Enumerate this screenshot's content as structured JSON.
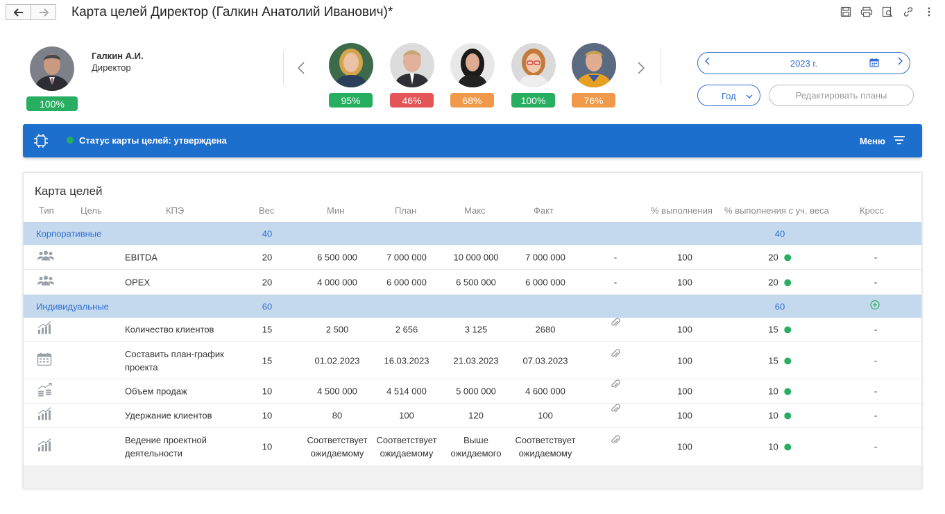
{
  "window": {
    "title": "Карта целей Директор (Галкин Анатолий Иванович)*"
  },
  "profile": {
    "name": "Галкин А.И.",
    "role": "Директор",
    "percent": "100%"
  },
  "team": [
    {
      "percent": "95%",
      "color": "#27ae60"
    },
    {
      "percent": "46%",
      "color": "#e45558"
    },
    {
      "percent": "68%",
      "color": "#f0994a"
    },
    {
      "percent": "100%",
      "color": "#27ae60"
    },
    {
      "percent": "76%",
      "color": "#f0994a"
    }
  ],
  "controls": {
    "year": "2023 г.",
    "period": "Год",
    "edit_plans": "Редактировать планы"
  },
  "status": {
    "text": "Статус карты целей: утверждена",
    "menu": "Меню"
  },
  "goals": {
    "title": "Карта целей",
    "headers": {
      "type": "Тип",
      "goal": "Цель",
      "kpi": "КПЭ",
      "weight": "Вес",
      "min": "Мин",
      "plan": "План",
      "max": "Макс",
      "fact": "Факт",
      "completion": "% выполнения",
      "weighted": "% выполнения с уч. веса",
      "cross": "Кросс"
    },
    "groups": [
      {
        "name": "Корпоративные",
        "weight": "40",
        "weighted": "40",
        "items": [
          {
            "icon": "group-icon",
            "kpi": [
              "EBITDA"
            ],
            "weight": "20",
            "min": [
              "6 500 000"
            ],
            "plan": [
              "7 000 000"
            ],
            "max": [
              "10 000 000"
            ],
            "fact": [
              "7 000 000"
            ],
            "attach": "-",
            "completion": "100",
            "weighted": "20",
            "cross": "-"
          },
          {
            "icon": "group-icon",
            "kpi": [
              "OPEX"
            ],
            "weight": "20",
            "min": [
              "4 000 000"
            ],
            "plan": [
              "6 000 000"
            ],
            "max": [
              "6 500 000"
            ],
            "fact": [
              "6 000 000"
            ],
            "attach": "-",
            "completion": "100",
            "weighted": "20",
            "cross": "-"
          }
        ]
      },
      {
        "name": "Индивидуальные",
        "weight": "60",
        "weighted": "60",
        "items": [
          {
            "icon": "bar-chart-icon",
            "kpi": [
              "Количество клиентов"
            ],
            "weight": "15",
            "min": [
              "2 500"
            ],
            "plan": [
              "2 656"
            ],
            "max": [
              "3 125"
            ],
            "fact": [
              "2680"
            ],
            "attach": "clip",
            "completion": "100",
            "weighted": "15",
            "cross": "-"
          },
          {
            "icon": "calendar-icon",
            "kpi": [
              "Составить план-график",
              "проекта"
            ],
            "weight": "15",
            "min": [
              "01.02.2023"
            ],
            "plan": [
              "16.03.2023"
            ],
            "max": [
              "21.03.2023"
            ],
            "fact": [
              "07.03.2023"
            ],
            "attach": "clip",
            "completion": "100",
            "weighted": "15",
            "cross": "-"
          },
          {
            "icon": "coins-chart-icon",
            "kpi": [
              "Объем продаж"
            ],
            "weight": "10",
            "min": [
              "4 500 000"
            ],
            "plan": [
              "4 514 000"
            ],
            "max": [
              "5 000 000"
            ],
            "fact": [
              "4 600 000"
            ],
            "attach": "clip",
            "completion": "100",
            "weighted": "10",
            "cross": "-"
          },
          {
            "icon": "bar-chart-icon",
            "kpi": [
              "Удержание клиентов"
            ],
            "weight": "10",
            "min": [
              "80"
            ],
            "plan": [
              "100"
            ],
            "max": [
              "120"
            ],
            "fact": [
              "100"
            ],
            "attach": "clip",
            "completion": "100",
            "weighted": "10",
            "cross": "-"
          },
          {
            "icon": "bar-chart-icon",
            "kpi": [
              "Ведение проектной",
              "деятельности"
            ],
            "weight": "10",
            "min": [
              "Соответствует",
              "ожидаемому"
            ],
            "plan": [
              "Соответствует",
              "ожидаемому"
            ],
            "max": [
              "Выше",
              "ожидаемого"
            ],
            "fact": [
              "Соответствует",
              "ожидаемому"
            ],
            "attach": "clip",
            "completion": "100",
            "weighted": "10",
            "cross": "-"
          }
        ]
      }
    ]
  }
}
